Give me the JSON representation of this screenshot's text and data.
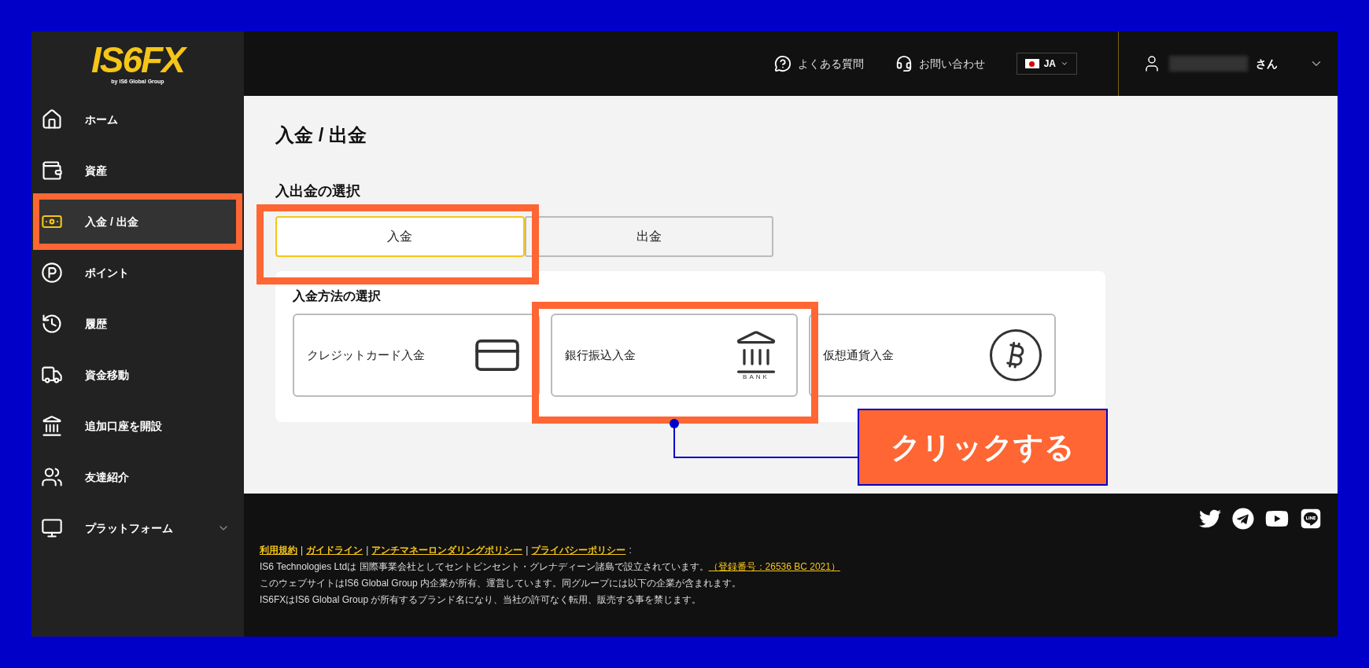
{
  "logo": {
    "title": "IS6FX",
    "subtitle": "by IS6 Global Group"
  },
  "sidebar": {
    "items": [
      {
        "label": "ホーム",
        "kind": "home",
        "selected": false,
        "expandable": false
      },
      {
        "label": "資産",
        "kind": "wallet",
        "selected": false,
        "expandable": false
      },
      {
        "label": "入金 / 出金",
        "kind": "money",
        "selected": true,
        "expandable": false
      },
      {
        "label": "ポイント",
        "kind": "points",
        "selected": false,
        "expandable": false
      },
      {
        "label": "履歴",
        "kind": "history",
        "selected": false,
        "expandable": false
      },
      {
        "label": "資金移動",
        "kind": "transfer",
        "selected": false,
        "expandable": false
      },
      {
        "label": "追加口座を開設",
        "kind": "bank",
        "selected": false,
        "expandable": false
      },
      {
        "label": "友達紹介",
        "kind": "friends",
        "selected": false,
        "expandable": false
      },
      {
        "label": "プラットフォーム",
        "kind": "platform",
        "selected": false,
        "expandable": true
      }
    ]
  },
  "header": {
    "links": [
      {
        "label": "よくある質問",
        "kind": "faq"
      },
      {
        "label": "お問い合わせ",
        "kind": "contact"
      }
    ],
    "language": "JA",
    "user_suffix": "さん"
  },
  "page": {
    "title": "入金 / 出金",
    "section_heading": "入出金の選択",
    "tabs": [
      {
        "label": "入金",
        "selected": true
      },
      {
        "label": "出金",
        "selected": false
      }
    ],
    "methods_heading": "入金方法の選択",
    "methods": [
      {
        "label": "クレジットカード入金",
        "kind": "card"
      },
      {
        "label": "銀行振込入金",
        "kind": "bank",
        "icon_text": "BANK"
      },
      {
        "label": "仮想通貨入金",
        "kind": "crypto"
      }
    ]
  },
  "annotation": {
    "callout": "クリックする"
  },
  "footer": {
    "links": [
      "利用規約",
      "ガイドライン",
      "アンチマネーロンダリングポリシー",
      "プライバシーポリシー"
    ],
    "separator": "|",
    "links_end": ":",
    "lines": [
      {
        "text": "IS6 Technologies Ltdは 国際事業会社としてセントビンセント・グレナディーン諸島で設立されています。",
        "link": "（登録番号：26536 BC 2021）"
      },
      {
        "text": "このウェブサイトはIS6 Global Group 内企業が所有、運営しています。同グループには以下の企業が含まれます。"
      },
      {
        "text": "IS6FXはIS6 Global Group が所有するブランド名になり、当社の許可なく転用、販売する事を禁じます。"
      }
    ]
  }
}
